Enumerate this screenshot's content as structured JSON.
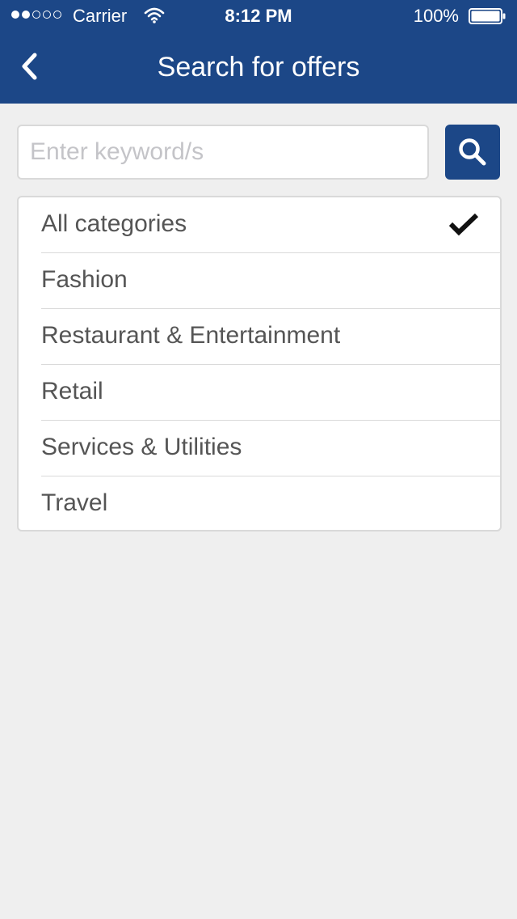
{
  "status_bar": {
    "carrier": "Carrier",
    "time": "8:12 PM",
    "battery_percent": "100%",
    "signal_icon": "signal-dots-icon",
    "wifi_icon": "wifi-icon",
    "battery_icon": "battery-icon",
    "battery_level": 1.0
  },
  "nav": {
    "title": "Search for offers",
    "back_icon": "chevron-left-icon"
  },
  "search": {
    "placeholder": "Enter keyword/s",
    "value": "",
    "button_icon": "search-icon"
  },
  "categories": [
    {
      "label": "All categories",
      "selected": true
    },
    {
      "label": "Fashion",
      "selected": false
    },
    {
      "label": "Restaurant & Entertainment",
      "selected": false
    },
    {
      "label": "Retail",
      "selected": false
    },
    {
      "label": "Services & Utilities",
      "selected": false
    },
    {
      "label": "Travel",
      "selected": false
    }
  ],
  "colors": {
    "primary": "#1c4787",
    "background": "#efefef",
    "text": "#555555",
    "placeholder": "#c4c4c8",
    "border": "#d9d9d9"
  }
}
